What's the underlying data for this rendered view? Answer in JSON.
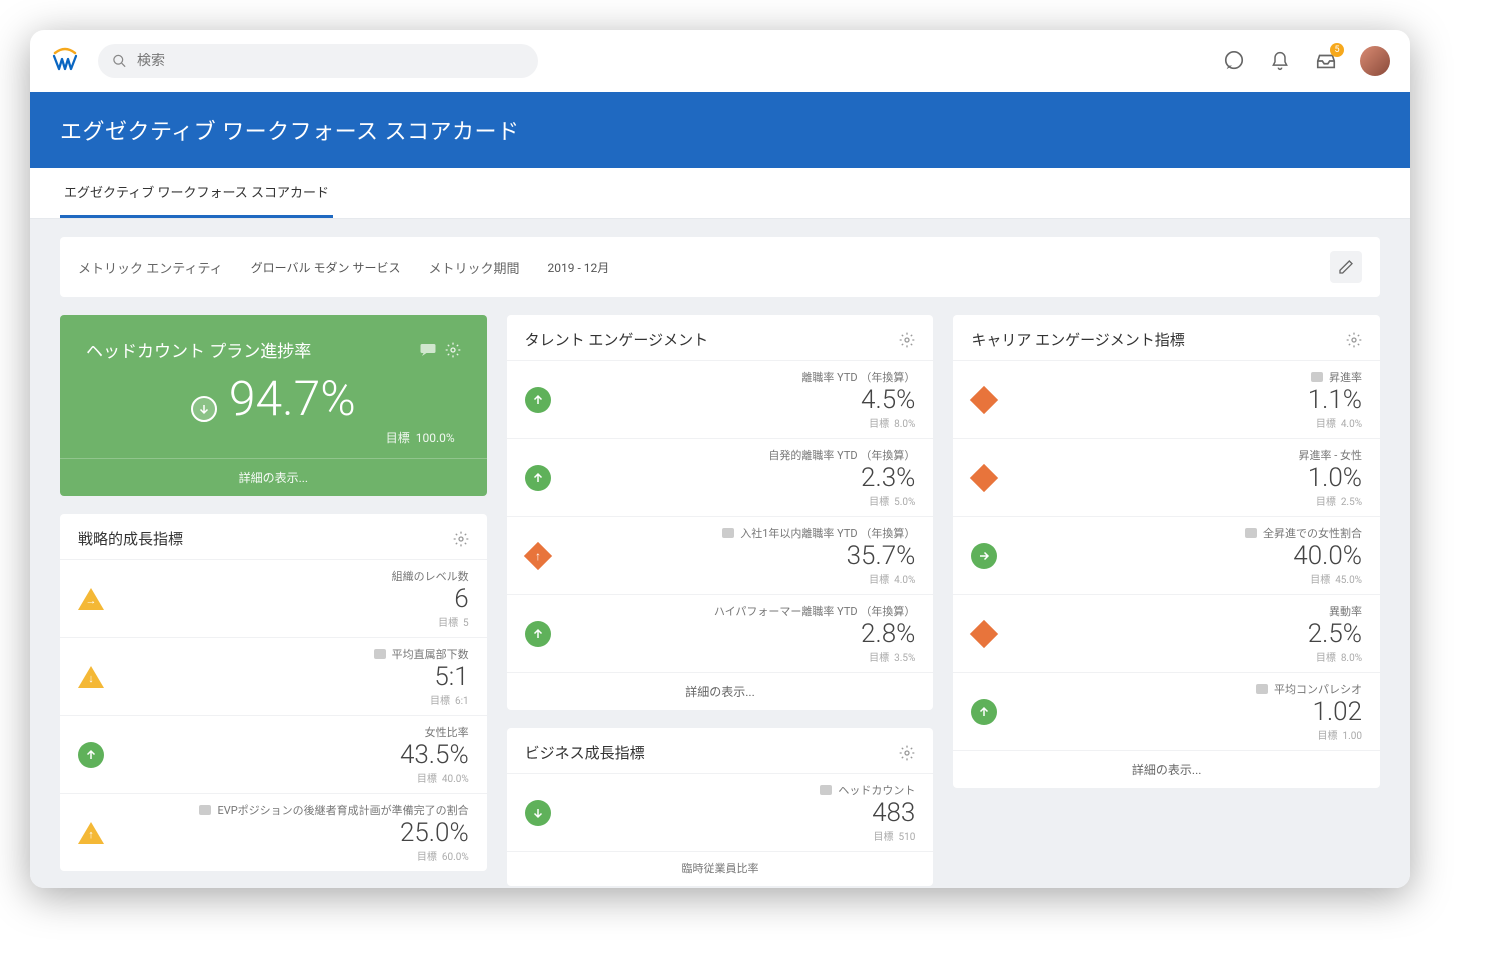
{
  "search": {
    "placeholder": "検索"
  },
  "notifications_badge": "5",
  "page_title": "エグゼクティブ ワークフォース スコアカード",
  "tab_label": "エグゼクティブ ワークフォース スコアカード",
  "filters": {
    "entity_label": "メトリック エンティティ",
    "entity_value": "グローバル モダン サービス",
    "period_label": "メトリック期間",
    "period_value": "2019 - 12月"
  },
  "hero": {
    "title": "ヘッドカウント プラン進捗率",
    "value": "94.7%",
    "target_label": "目標",
    "target_value": "100.0%",
    "footer": "詳細の表示..."
  },
  "card_growth": {
    "title": "戦略的成長指標",
    "metrics": [
      {
        "label": "組織のレベル数",
        "value": "6",
        "target_label": "目標",
        "target_value": "5",
        "indicator": "tri-right"
      },
      {
        "label": "平均直属部下数",
        "value": "5:1",
        "target_label": "目標",
        "target_value": "6:1",
        "indicator": "tri-down",
        "chat": true
      },
      {
        "label": "女性比率",
        "value": "43.5%",
        "target_label": "目標",
        "target_value": "40.0%",
        "indicator": "circle-up"
      },
      {
        "label": "EVPポジションの後継者育成計画が準備完了の割合",
        "value": "25.0%",
        "target_label": "目標",
        "target_value": "60.0%",
        "indicator": "tri-up",
        "chat": true
      }
    ]
  },
  "card_talent": {
    "title": "タレント エンゲージメント",
    "metrics": [
      {
        "label": "離職率 YTD （年換算）",
        "value": "4.5%",
        "target_label": "目標",
        "target_value": "8.0%",
        "indicator": "circle-up"
      },
      {
        "label": "自発的離職率 YTD （年換算）",
        "value": "2.3%",
        "target_label": "目標",
        "target_value": "5.0%",
        "indicator": "circle-up"
      },
      {
        "label": "入社1年以内離職率 YTD （年換算）",
        "value": "35.7%",
        "target_label": "目標",
        "target_value": "4.0%",
        "indicator": "diamond-up",
        "chat": true
      },
      {
        "label": "ハイパフォーマー離職率 YTD （年換算）",
        "value": "2.8%",
        "target_label": "目標",
        "target_value": "3.5%",
        "indicator": "circle-up"
      }
    ],
    "footer": "詳細の表示..."
  },
  "card_business": {
    "title": "ビジネス成長指標",
    "metrics": [
      {
        "label": "ヘッドカウント",
        "value": "483",
        "target_label": "目標",
        "target_value": "510",
        "indicator": "circle-down",
        "chat": true
      },
      {
        "label": "臨時従業員比率",
        "value": "",
        "target_label": "",
        "target_value": "",
        "indicator": "none"
      }
    ]
  },
  "card_career": {
    "title": "キャリア エンゲージメント指標",
    "metrics": [
      {
        "label": "昇進率",
        "value": "1.1%",
        "target_label": "目標",
        "target_value": "4.0%",
        "indicator": "diamond",
        "chat": true
      },
      {
        "label": "昇進率 - 女性",
        "value": "1.0%",
        "target_label": "目標",
        "target_value": "2.5%",
        "indicator": "diamond"
      },
      {
        "label": "全昇進での女性割合",
        "value": "40.0%",
        "target_label": "目標",
        "target_value": "45.0%",
        "indicator": "circle-right",
        "chat": true
      },
      {
        "label": "異動率",
        "value": "2.5%",
        "target_label": "目標",
        "target_value": "8.0%",
        "indicator": "diamond"
      },
      {
        "label": "平均コンパレシオ",
        "value": "1.02",
        "target_label": "目標",
        "target_value": "1.00",
        "indicator": "circle-up",
        "chat": true
      }
    ],
    "footer": "詳細の表示..."
  }
}
